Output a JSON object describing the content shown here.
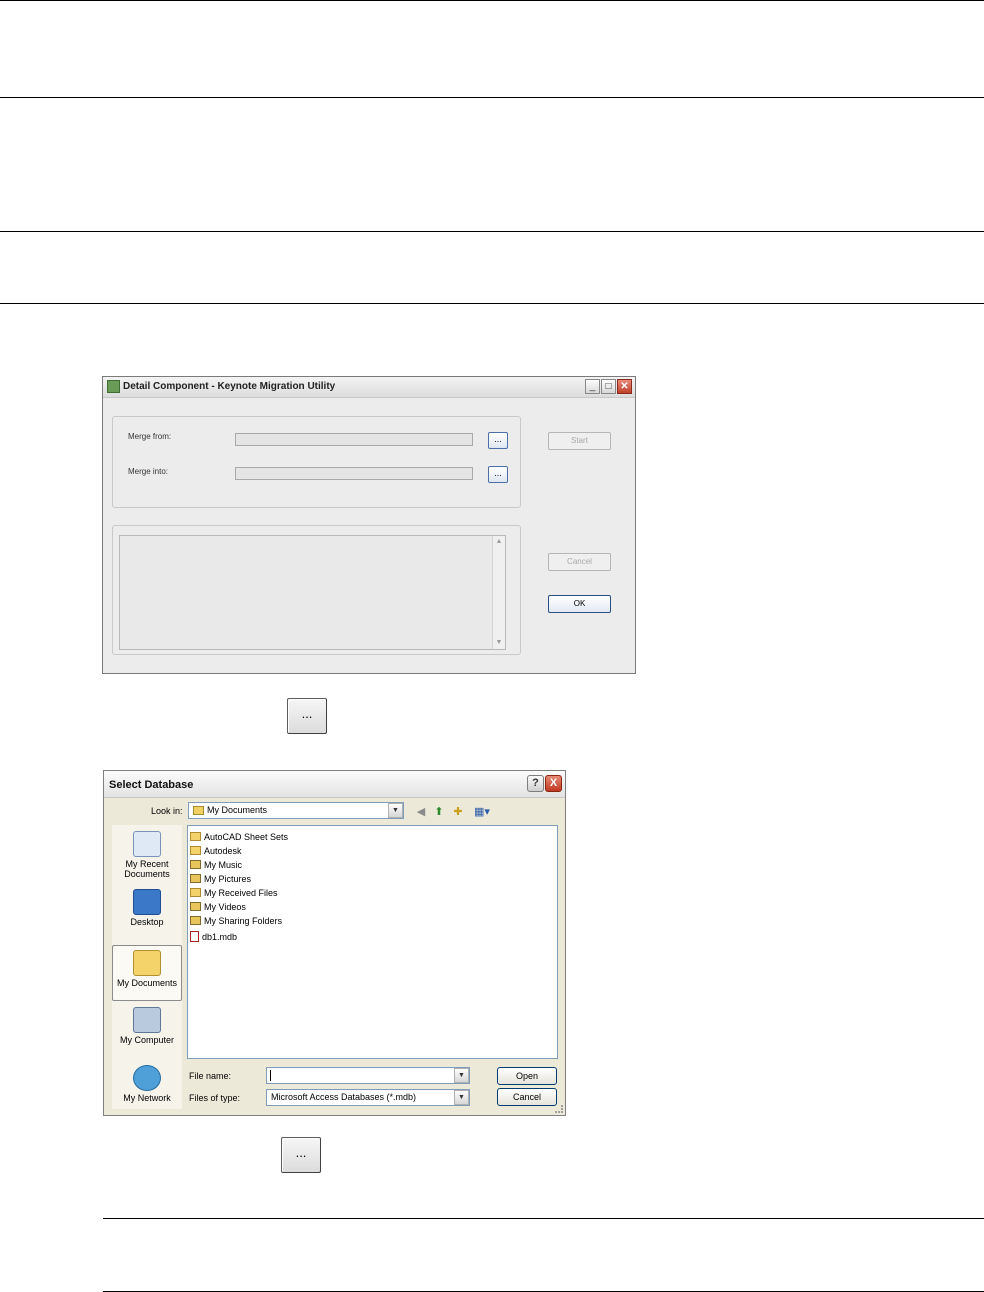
{
  "migration_window": {
    "title": "Detail Component - Keynote Migration Utility",
    "merge_from_label": "Merge from:",
    "merge_into_label": "Merge into:",
    "browse_label": "...",
    "start_label": "Start",
    "cancel_label": "Cancel",
    "ok_label": "OK"
  },
  "ellipsis_button_1": {
    "label": "..."
  },
  "ellipsis_button_2": {
    "label": "..."
  },
  "select_dialog": {
    "title": "Select Database",
    "help_label": "?",
    "close_label": "X",
    "look_in_label": "Look in:",
    "look_in_value": "My Documents",
    "places": [
      {
        "label": "My Recent Documents",
        "icon": "recent-documents-icon"
      },
      {
        "label": "Desktop",
        "icon": "desktop-icon"
      },
      {
        "label": "My Documents",
        "icon": "my-documents-icon"
      },
      {
        "label": "My Computer",
        "icon": "my-computer-icon"
      },
      {
        "label": "My Network",
        "icon": "my-network-icon"
      }
    ],
    "files": [
      {
        "name": "AutoCAD Sheet Sets",
        "icon": "folder-icon"
      },
      {
        "name": "Autodesk",
        "icon": "folder-icon"
      },
      {
        "name": "My Music",
        "icon": "music-folder-icon"
      },
      {
        "name": "My Pictures",
        "icon": "pictures-folder-icon"
      },
      {
        "name": "My Received Files",
        "icon": "folder-icon"
      },
      {
        "name": "My Videos",
        "icon": "videos-folder-icon"
      },
      {
        "name": "My Sharing Folders",
        "icon": "sharing-folder-icon"
      },
      {
        "name": "db1.mdb",
        "icon": "access-database-icon"
      }
    ],
    "file_name_label": "File name:",
    "file_name_value": "",
    "files_of_type_label": "Files of type:",
    "files_of_type_value": "Microsoft Access Databases  (*.mdb)",
    "open_label": "Open",
    "cancel_label": "Cancel"
  }
}
